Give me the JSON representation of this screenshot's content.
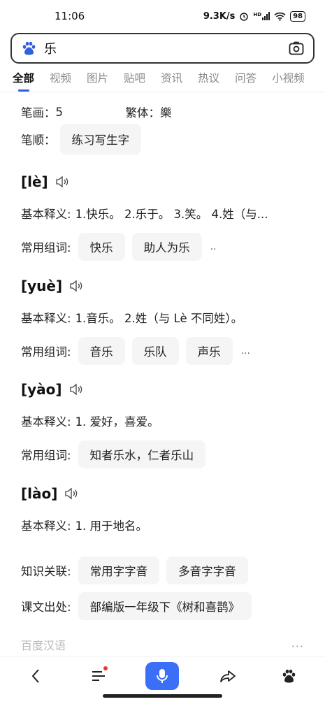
{
  "status_bar": {
    "time": "11:06",
    "net_speed": "9.3K/s",
    "signal_label": "HD",
    "battery": "98"
  },
  "search": {
    "query": "乐"
  },
  "tabs": [
    "全部",
    "视频",
    "图片",
    "贴吧",
    "资讯",
    "热议",
    "问答",
    "小视频"
  ],
  "entry": {
    "strokes_label": "笔画：",
    "strokes_value": "5",
    "traditional_label": "繁体：",
    "traditional_value": "樂",
    "stroke_order_label": "笔顺：",
    "stroke_order_button": "练习写生字",
    "readings": [
      {
        "pinyin": "[lè]",
        "definition_label": "基本释义:",
        "definition": "1.快乐。 2.乐于。 3.笑。 4.姓（与...",
        "words_label": "常用组词:",
        "words": [
          "快乐",
          "助人为乐"
        ],
        "more": ".."
      },
      {
        "pinyin": "[yuè]",
        "definition_label": "基本释义:",
        "definition": "1.音乐。 2.姓（与 Lè 不同姓）。",
        "words_label": "常用组词:",
        "words": [
          "音乐",
          "乐队",
          "声乐"
        ],
        "more": "..."
      },
      {
        "pinyin": "[yào]",
        "definition_label": "基本释义:",
        "definition": "1. 爱好，喜爱。",
        "words_label": "常用组词:",
        "words": [
          "知者乐水，仁者乐山"
        ]
      },
      {
        "pinyin": "[lào]",
        "definition_label": "基本释义:",
        "definition": "1. 用于地名。"
      }
    ],
    "knowledge_label": "知识关联:",
    "knowledge": [
      "常用字字音",
      "多音字字音"
    ],
    "textbook_label": "课文出处:",
    "textbook": "部编版一年级下《树和喜鹊》",
    "source": "百度汉语",
    "more_dots": "···"
  },
  "icons": {
    "logo": "baidu-paw-icon",
    "camera": "camera-icon",
    "speaker": "speaker-icon",
    "back": "back-arrow-icon",
    "menu": "menu-icon",
    "mic": "microphone-icon",
    "share": "share-icon",
    "home": "baidu-home-icon"
  },
  "colors": {
    "accent": "#3c6ff7",
    "chip_bg": "#f5f5f6",
    "notification_dot": "#e33333"
  }
}
